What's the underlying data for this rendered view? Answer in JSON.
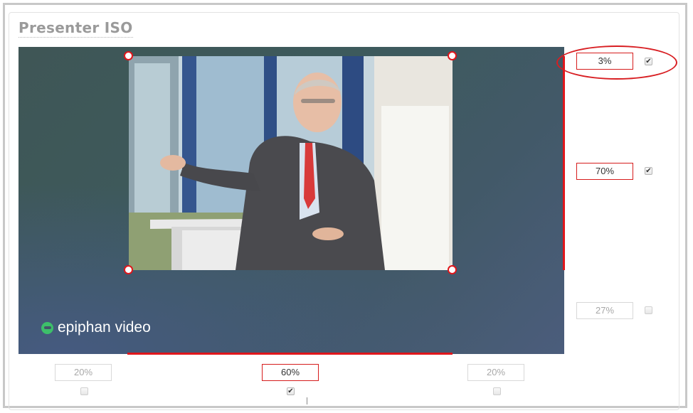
{
  "panel": {
    "title": "Presenter ISO"
  },
  "layout_controls": {
    "top": {
      "value": "3%",
      "checked": true
    },
    "height": {
      "value": "70%",
      "checked": true
    },
    "bottom": {
      "value": "27%",
      "checked": false
    },
    "left": {
      "value": "20%",
      "checked": false
    },
    "width": {
      "value": "60%",
      "checked": true
    },
    "right": {
      "value": "20%",
      "checked": false
    }
  },
  "background": {
    "logo_text": "epiphan video"
  },
  "icons": {
    "checkbox_checked": "✔",
    "logo": "epiphan-logo-icon"
  },
  "colors": {
    "accent_red": "#e0161b",
    "logo_green": "#3dbf6a",
    "title_gray": "#9a9a9a"
  }
}
